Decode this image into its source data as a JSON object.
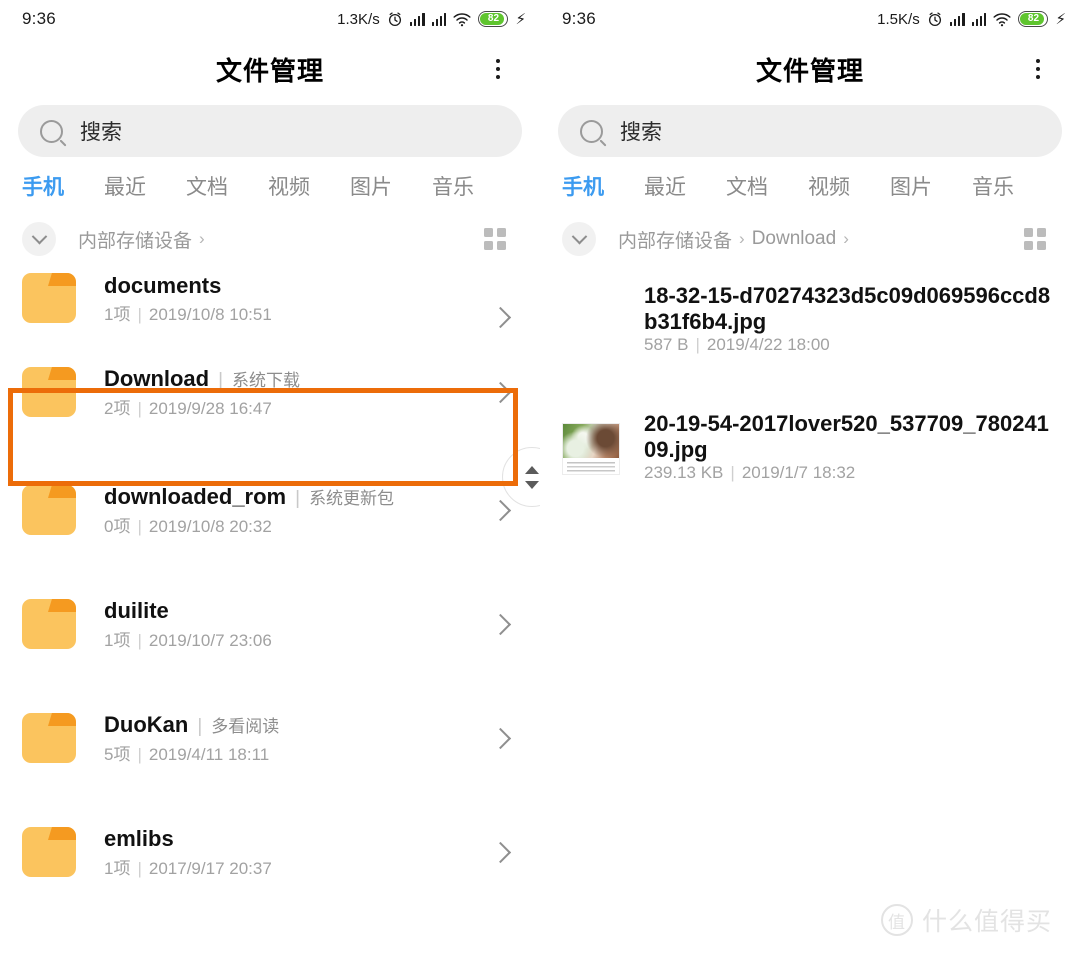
{
  "colors": {
    "accent_tab": "#3c9bf0",
    "highlight_border": "#ec6c09",
    "folder_body": "#fbc45e",
    "folder_tab": "#f59a20",
    "battery_fill": "#5fc52e"
  },
  "left_panel": {
    "status": {
      "time": "9:36",
      "net_speed": "1.3K/s",
      "battery_level": "82",
      "icons": [
        "alarm-icon",
        "signal-icon",
        "signal-icon",
        "wifi-icon",
        "battery-icon",
        "charging-bolt-icon"
      ]
    },
    "header": {
      "title": "文件管理",
      "menu_icon": "more-vertical-icon"
    },
    "search": {
      "placeholder": "搜索",
      "icon": "search-icon"
    },
    "tabs": [
      {
        "label": "手机",
        "active": true
      },
      {
        "label": "最近",
        "active": false
      },
      {
        "label": "文档",
        "active": false
      },
      {
        "label": "视频",
        "active": false
      },
      {
        "label": "图片",
        "active": false
      },
      {
        "label": "音乐",
        "active": false
      }
    ],
    "breadcrumb": {
      "collapse_icon": "chevron-down-icon",
      "segments": [
        "内部存储设备"
      ],
      "separator": "›",
      "view_toggle_icon": "grid-view-icon"
    },
    "items": [
      {
        "name": "documents",
        "alias": "",
        "count": "1项",
        "date": "2019/10/8 10:51",
        "clipped": true,
        "highlighted": false
      },
      {
        "name": "Download",
        "alias": "系统下载",
        "count": "2项",
        "date": "2019/9/28 16:47",
        "clipped": false,
        "highlighted": true
      },
      {
        "name": "downloaded_rom",
        "alias": "系统更新包",
        "count": "0项",
        "date": "2019/10/8 20:32",
        "clipped": false,
        "highlighted": false
      },
      {
        "name": "duilite",
        "alias": "",
        "count": "1项",
        "date": "2019/10/7 23:06",
        "clipped": false,
        "highlighted": false
      },
      {
        "name": "DuoKan",
        "alias": "多看阅读",
        "count": "5项",
        "date": "2019/4/11 18:11",
        "clipped": false,
        "highlighted": false
      },
      {
        "name": "emlibs",
        "alias": "",
        "count": "1项",
        "date": "2017/9/17 20:37",
        "clipped": false,
        "highlighted": false
      }
    ]
  },
  "right_panel": {
    "status": {
      "time": "9:36",
      "net_speed": "1.5K/s",
      "battery_level": "82",
      "icons": [
        "alarm-icon",
        "signal-icon",
        "signal-icon",
        "wifi-icon",
        "battery-icon",
        "charging-bolt-icon"
      ]
    },
    "header": {
      "title": "文件管理",
      "menu_icon": "more-vertical-icon"
    },
    "search": {
      "placeholder": "搜索",
      "icon": "search-icon"
    },
    "tabs": [
      {
        "label": "手机",
        "active": true
      },
      {
        "label": "最近",
        "active": false
      },
      {
        "label": "文档",
        "active": false
      },
      {
        "label": "视频",
        "active": false
      },
      {
        "label": "图片",
        "active": false
      },
      {
        "label": "音乐",
        "active": false
      }
    ],
    "breadcrumb": {
      "collapse_icon": "chevron-down-icon",
      "segments": [
        "内部存储设备",
        "Download"
      ],
      "separator": "›",
      "view_toggle_icon": "grid-view-icon"
    },
    "files": [
      {
        "name": "18-32-15-d70274323d5c09d069596ccd8b31f6b4.jpg",
        "size": "587 B",
        "date": "2019/4/22 18:00",
        "has_thumbnail": false
      },
      {
        "name": "20-19-54-2017lover520_537709_78024109.jpg",
        "size": "239.13 KB",
        "date": "2019/1/7 18:32",
        "has_thumbnail": true
      }
    ]
  },
  "watermark": {
    "logo_char": "值",
    "text": "什么值得买"
  }
}
